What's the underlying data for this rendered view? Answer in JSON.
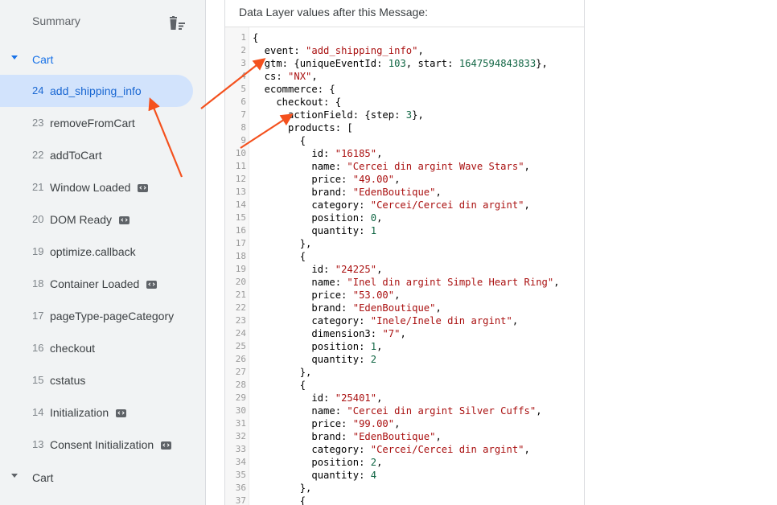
{
  "sidebar": {
    "summary_label": "Summary",
    "groups": [
      {
        "label": "Cart"
      },
      {
        "label": "Cart"
      }
    ],
    "events": [
      {
        "num": "24",
        "name": "add_shipping_info",
        "tag": false,
        "selected": true
      },
      {
        "num": "23",
        "name": "removeFromCart",
        "tag": false
      },
      {
        "num": "22",
        "name": "addToCart",
        "tag": false
      },
      {
        "num": "21",
        "name": "Window Loaded",
        "tag": true
      },
      {
        "num": "20",
        "name": "DOM Ready",
        "tag": true
      },
      {
        "num": "19",
        "name": "optimize.callback",
        "tag": false
      },
      {
        "num": "18",
        "name": "Container Loaded",
        "tag": true
      },
      {
        "num": "17",
        "name": "pageType-pageCategory",
        "tag": false
      },
      {
        "num": "16",
        "name": "checkout",
        "tag": false
      },
      {
        "num": "15",
        "name": "cstatus",
        "tag": false
      },
      {
        "num": "14",
        "name": "Initialization",
        "tag": true
      },
      {
        "num": "13",
        "name": "Consent Initialization",
        "tag": true
      }
    ]
  },
  "panel": {
    "title": "Data Layer values after this Message:",
    "code_lines": [
      [
        {
          "t": "p",
          "v": "{"
        }
      ],
      [
        {
          "t": "p",
          "v": "  event: "
        },
        {
          "t": "s",
          "v": "\"add_shipping_info\""
        },
        {
          "t": "p",
          "v": ","
        }
      ],
      [
        {
          "t": "p",
          "v": "  gtm: {uniqueEventId: "
        },
        {
          "t": "n",
          "v": "103"
        },
        {
          "t": "p",
          "v": ", start: "
        },
        {
          "t": "n",
          "v": "1647594843833"
        },
        {
          "t": "p",
          "v": "},"
        }
      ],
      [
        {
          "t": "p",
          "v": "  cs: "
        },
        {
          "t": "s",
          "v": "\"NX\""
        },
        {
          "t": "p",
          "v": ","
        }
      ],
      [
        {
          "t": "p",
          "v": "  ecommerce: {"
        }
      ],
      [
        {
          "t": "p",
          "v": "    checkout: {"
        }
      ],
      [
        {
          "t": "p",
          "v": "      actionField: {step: "
        },
        {
          "t": "n",
          "v": "3"
        },
        {
          "t": "p",
          "v": "},"
        }
      ],
      [
        {
          "t": "p",
          "v": "      products: ["
        }
      ],
      [
        {
          "t": "p",
          "v": "        {"
        }
      ],
      [
        {
          "t": "p",
          "v": "          id: "
        },
        {
          "t": "s",
          "v": "\"16185\""
        },
        {
          "t": "p",
          "v": ","
        }
      ],
      [
        {
          "t": "p",
          "v": "          name: "
        },
        {
          "t": "s",
          "v": "\"Cercei din argint Wave Stars\""
        },
        {
          "t": "p",
          "v": ","
        }
      ],
      [
        {
          "t": "p",
          "v": "          price: "
        },
        {
          "t": "s",
          "v": "\"49.00\""
        },
        {
          "t": "p",
          "v": ","
        }
      ],
      [
        {
          "t": "p",
          "v": "          brand: "
        },
        {
          "t": "s",
          "v": "\"EdenBoutique\""
        },
        {
          "t": "p",
          "v": ","
        }
      ],
      [
        {
          "t": "p",
          "v": "          category: "
        },
        {
          "t": "s",
          "v": "\"Cercei/Cercei din argint\""
        },
        {
          "t": "p",
          "v": ","
        }
      ],
      [
        {
          "t": "p",
          "v": "          position: "
        },
        {
          "t": "n",
          "v": "0"
        },
        {
          "t": "p",
          "v": ","
        }
      ],
      [
        {
          "t": "p",
          "v": "          quantity: "
        },
        {
          "t": "n",
          "v": "1"
        }
      ],
      [
        {
          "t": "p",
          "v": "        },"
        }
      ],
      [
        {
          "t": "p",
          "v": "        {"
        }
      ],
      [
        {
          "t": "p",
          "v": "          id: "
        },
        {
          "t": "s",
          "v": "\"24225\""
        },
        {
          "t": "p",
          "v": ","
        }
      ],
      [
        {
          "t": "p",
          "v": "          name: "
        },
        {
          "t": "s",
          "v": "\"Inel din argint Simple Heart Ring\""
        },
        {
          "t": "p",
          "v": ","
        }
      ],
      [
        {
          "t": "p",
          "v": "          price: "
        },
        {
          "t": "s",
          "v": "\"53.00\""
        },
        {
          "t": "p",
          "v": ","
        }
      ],
      [
        {
          "t": "p",
          "v": "          brand: "
        },
        {
          "t": "s",
          "v": "\"EdenBoutique\""
        },
        {
          "t": "p",
          "v": ","
        }
      ],
      [
        {
          "t": "p",
          "v": "          category: "
        },
        {
          "t": "s",
          "v": "\"Inele/Inele din argint\""
        },
        {
          "t": "p",
          "v": ","
        }
      ],
      [
        {
          "t": "p",
          "v": "          dimension3: "
        },
        {
          "t": "s",
          "v": "\"7\""
        },
        {
          "t": "p",
          "v": ","
        }
      ],
      [
        {
          "t": "p",
          "v": "          position: "
        },
        {
          "t": "n",
          "v": "1"
        },
        {
          "t": "p",
          "v": ","
        }
      ],
      [
        {
          "t": "p",
          "v": "          quantity: "
        },
        {
          "t": "n",
          "v": "2"
        }
      ],
      [
        {
          "t": "p",
          "v": "        },"
        }
      ],
      [
        {
          "t": "p",
          "v": "        {"
        }
      ],
      [
        {
          "t": "p",
          "v": "          id: "
        },
        {
          "t": "s",
          "v": "\"25401\""
        },
        {
          "t": "p",
          "v": ","
        }
      ],
      [
        {
          "t": "p",
          "v": "          name: "
        },
        {
          "t": "s",
          "v": "\"Cercei din argint Silver Cuffs\""
        },
        {
          "t": "p",
          "v": ","
        }
      ],
      [
        {
          "t": "p",
          "v": "          price: "
        },
        {
          "t": "s",
          "v": "\"99.00\""
        },
        {
          "t": "p",
          "v": ","
        }
      ],
      [
        {
          "t": "p",
          "v": "          brand: "
        },
        {
          "t": "s",
          "v": "\"EdenBoutique\""
        },
        {
          "t": "p",
          "v": ","
        }
      ],
      [
        {
          "t": "p",
          "v": "          category: "
        },
        {
          "t": "s",
          "v": "\"Cercei/Cercei din argint\""
        },
        {
          "t": "p",
          "v": ","
        }
      ],
      [
        {
          "t": "p",
          "v": "          position: "
        },
        {
          "t": "n",
          "v": "2"
        },
        {
          "t": "p",
          "v": ","
        }
      ],
      [
        {
          "t": "p",
          "v": "          quantity: "
        },
        {
          "t": "n",
          "v": "4"
        }
      ],
      [
        {
          "t": "p",
          "v": "        },"
        }
      ],
      [
        {
          "t": "p",
          "v": "        {"
        }
      ]
    ]
  },
  "colors": {
    "accent": "#1a73e8",
    "selected_bg": "#d2e3fc",
    "annotation_arrow": "#f4511e",
    "code_string": "#a11",
    "code_number": "#164"
  },
  "icons": {
    "clear": "delete-sweep-icon",
    "tag": "code-tag-icon",
    "group": "chevron-down-icon"
  }
}
